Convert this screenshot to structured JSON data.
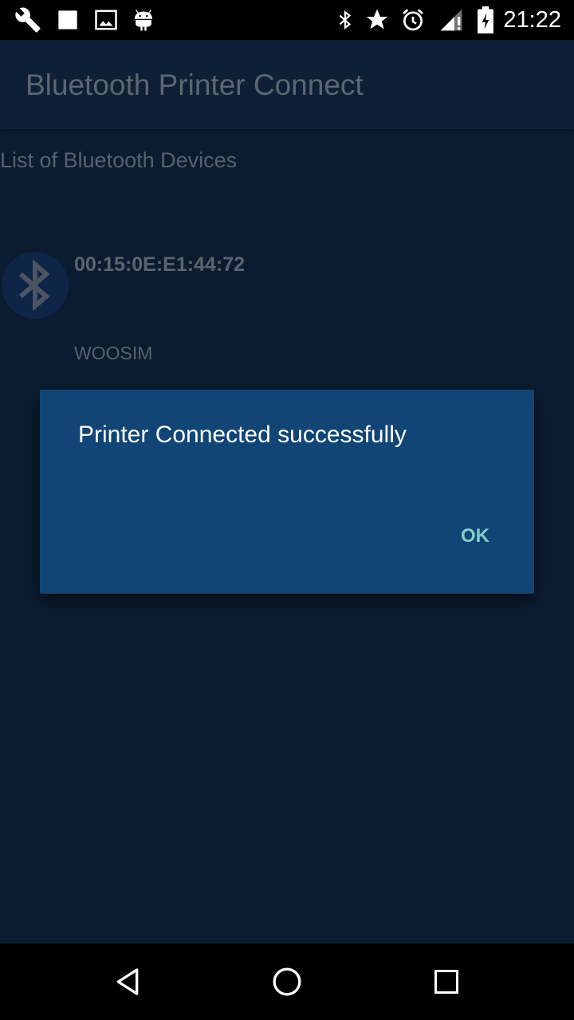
{
  "status_bar": {
    "time": "21:22",
    "left_icons": [
      "wrench-icon",
      "square-notification-icon",
      "image-icon",
      "android-icon"
    ],
    "right_icons": [
      "bluetooth-icon",
      "star-icon",
      "alarm-icon",
      "signal-icon",
      "battery-charging-icon"
    ]
  },
  "app_bar": {
    "title": "Bluetooth Printer Connect"
  },
  "list": {
    "header": "List of Bluetooth Devices",
    "devices": [
      {
        "address": "00:15:0E:E1:44:72",
        "name": "WOOSIM",
        "icon": "bluetooth-icon"
      }
    ]
  },
  "dialog": {
    "message": "Printer Connected successfully",
    "ok_label": "OK"
  },
  "nav_bar": {
    "buttons": [
      "back-icon",
      "home-icon",
      "recents-icon"
    ]
  },
  "colors": {
    "dialog_background": "#114575",
    "dialog_button": "#7fcfc9",
    "screen_dimmed": "#0b1c30"
  }
}
